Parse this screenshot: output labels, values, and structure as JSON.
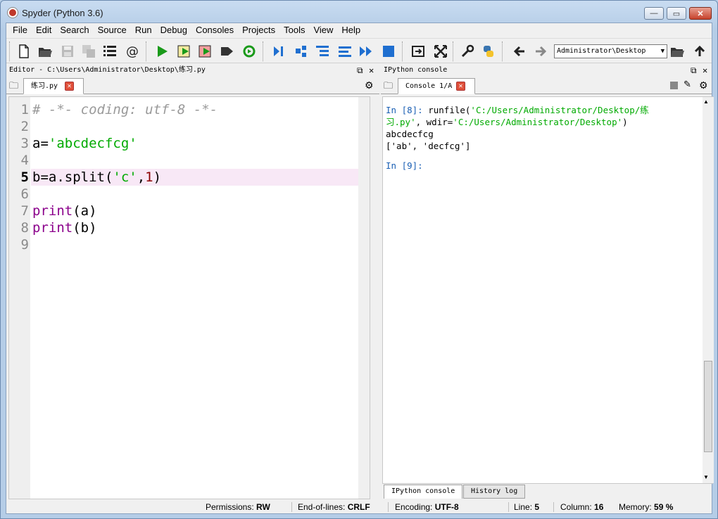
{
  "window": {
    "title": "Spyder (Python 3.6)",
    "minimize": "—",
    "maximize": "▭",
    "close": "✕"
  },
  "menu": [
    "File",
    "Edit",
    "Search",
    "Source",
    "Run",
    "Debug",
    "Consoles",
    "Projects",
    "Tools",
    "View",
    "Help"
  ],
  "toolbar": {
    "path_combo": "Administrator\\Desktop"
  },
  "editor": {
    "pane_title": "Editor - C:\\Users\\Administrator\\Desktop\\练习.py",
    "tab_label": "练习.py",
    "current_line": 5,
    "line_numbers": [
      "1",
      "2",
      "3",
      "4",
      "5",
      "6",
      "7",
      "8",
      "9"
    ],
    "lines": [
      "# -*- coding: utf-8 -*-",
      "",
      "a='abcdecfcg'",
      "",
      "b=a.split('c',1)",
      "",
      "print(a)",
      "print(b)",
      ""
    ]
  },
  "console": {
    "pane_title": "IPython console",
    "tab_label": "Console 1/A",
    "lines": [
      "In [8]: runfile('C:/Users/Administrator/Desktop/练",
      "习.py', wdir='C:/Users/Administrator/Desktop')",
      "abcdecfcg",
      "['ab', 'decfcg']",
      "",
      "In [9]:"
    ],
    "bottom_tabs": [
      "IPython console",
      "History log"
    ]
  },
  "status": {
    "permissions_label": "Permissions:",
    "permissions": "RW",
    "eol_label": "End-of-lines:",
    "eol": "CRLF",
    "encoding_label": "Encoding:",
    "encoding": "UTF-8",
    "line_label": "Line:",
    "line": "5",
    "column_label": "Column:",
    "column": "16",
    "memory_label": "Memory:",
    "memory": "59 %"
  },
  "colors": {
    "accent": "#1a5fb4",
    "string": "#00aa00",
    "keyword": "#8b008b",
    "number": "#8b0000",
    "current_line": "#f8e8f6"
  }
}
